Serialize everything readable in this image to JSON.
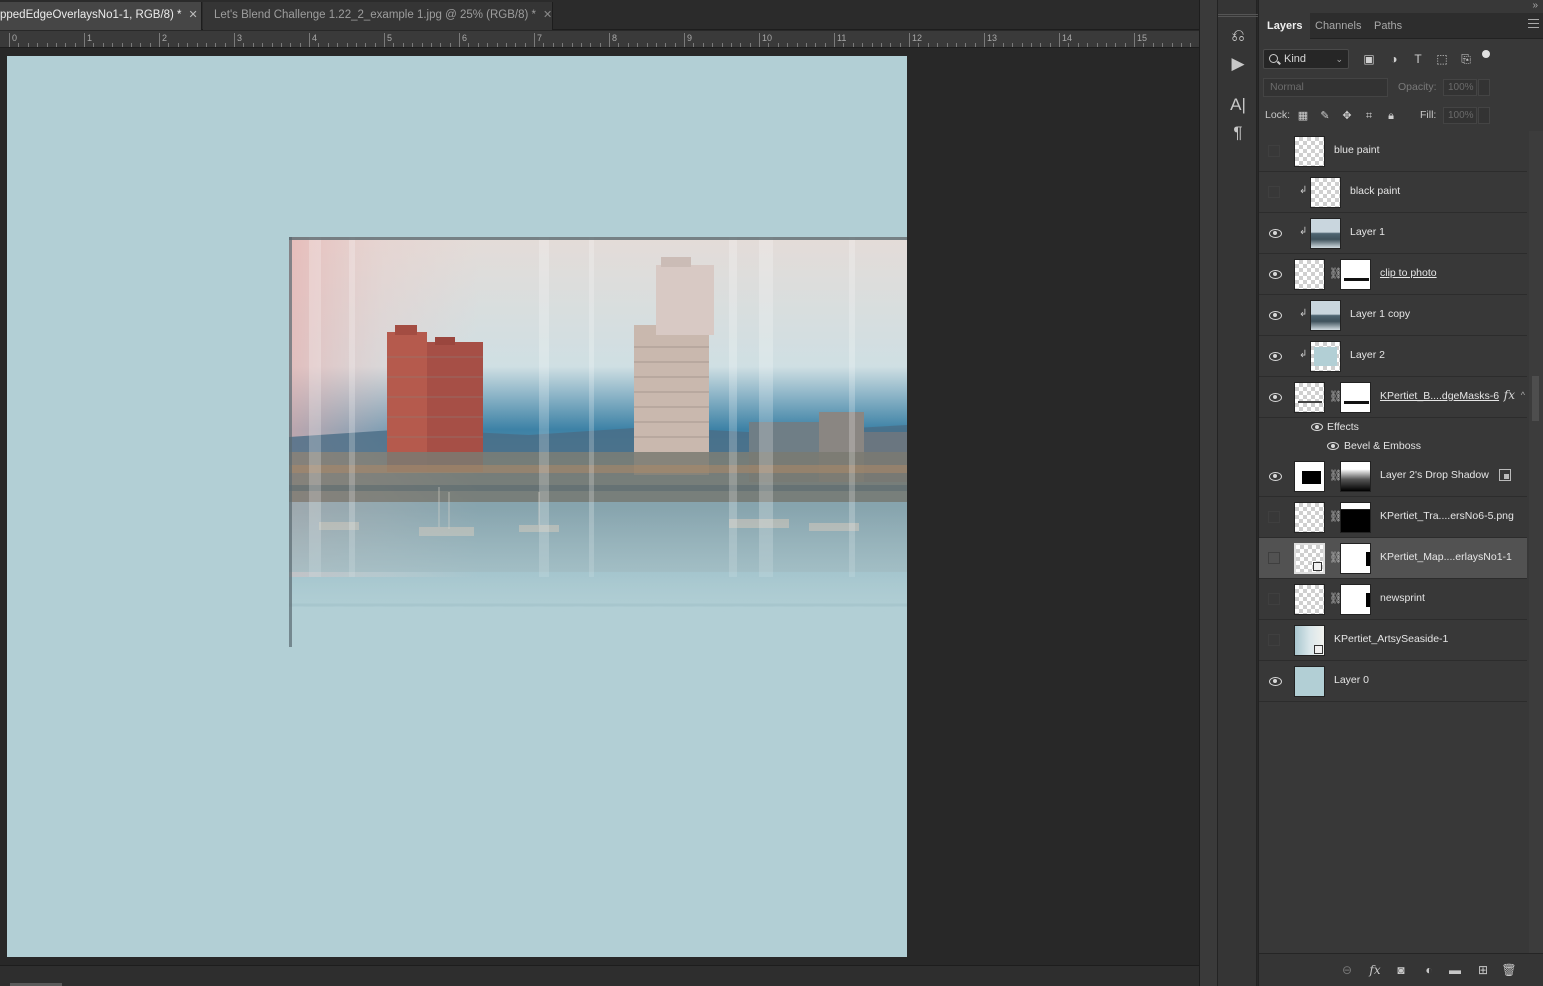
{
  "document_tabs": [
    {
      "label": "ppedEdgeOverlaysNo1-1, RGB/8) *",
      "active": true
    },
    {
      "label": "Let's Blend Challenge 1.22_2_example 1.jpg @ 25% (RGB/8) *",
      "active": false
    }
  ],
  "ruler_labels": [
    "0",
    "1",
    "2",
    "3",
    "4",
    "5",
    "6",
    "7",
    "8",
    "9",
    "10",
    "11",
    "12",
    "13",
    "14",
    "15"
  ],
  "colors": {
    "canvas_background": "#b2cfd5",
    "workspace": "#282828",
    "panel": "#383838"
  },
  "panel": {
    "tabs": [
      "Layers",
      "Channels",
      "Paths"
    ],
    "active_tab": "Layers",
    "filter_kind": "Kind",
    "blend_mode": "Normal",
    "opacity_label": "Opacity:",
    "opacity_value": "100%",
    "lock_label": "Lock:",
    "fill_label": "Fill:",
    "fill_value": "100%"
  },
  "layers": [
    {
      "name": "blue paint",
      "visible": false
    },
    {
      "name": "black paint",
      "visible": false,
      "clipped": true
    },
    {
      "name": "Layer 1",
      "visible": true,
      "clipped": true
    },
    {
      "name": "clip to photo",
      "visible": true,
      "mask": true
    },
    {
      "name": "Layer 1 copy",
      "visible": true,
      "clipped": true
    },
    {
      "name": "Layer 2",
      "visible": true,
      "clipped": true
    },
    {
      "name": "KPertiet_B....dgeMasks-6",
      "visible": true,
      "mask": true,
      "fx": "fx"
    },
    {
      "name": "Layer 2's Drop Shadow",
      "visible": true,
      "mask": true
    },
    {
      "name": "KPertiet_Tra....ersNo6-5.png",
      "visible": false,
      "mask": true
    },
    {
      "name": "KPertiet_Map....erlaysNo1-1",
      "visible": false,
      "mask": true,
      "selected": true
    },
    {
      "name": "newsprint",
      "visible": false,
      "mask": true
    },
    {
      "name": "KPertiet_ArtsySeaside-1",
      "visible": false
    },
    {
      "name": "Layer 0",
      "visible": true
    }
  ],
  "effects": {
    "group_label": "Effects",
    "items": [
      "Bevel & Emboss"
    ]
  },
  "icons": {
    "strip": [
      "history-brush-icon",
      "play-action-icon",
      "character-icon",
      "paragraph-icon"
    ],
    "footer": [
      "link-layers-icon",
      "fx-icon",
      "add-mask-icon",
      "adjustment-layer-icon",
      "new-group-icon",
      "new-layer-icon",
      "delete-layer-icon"
    ]
  }
}
